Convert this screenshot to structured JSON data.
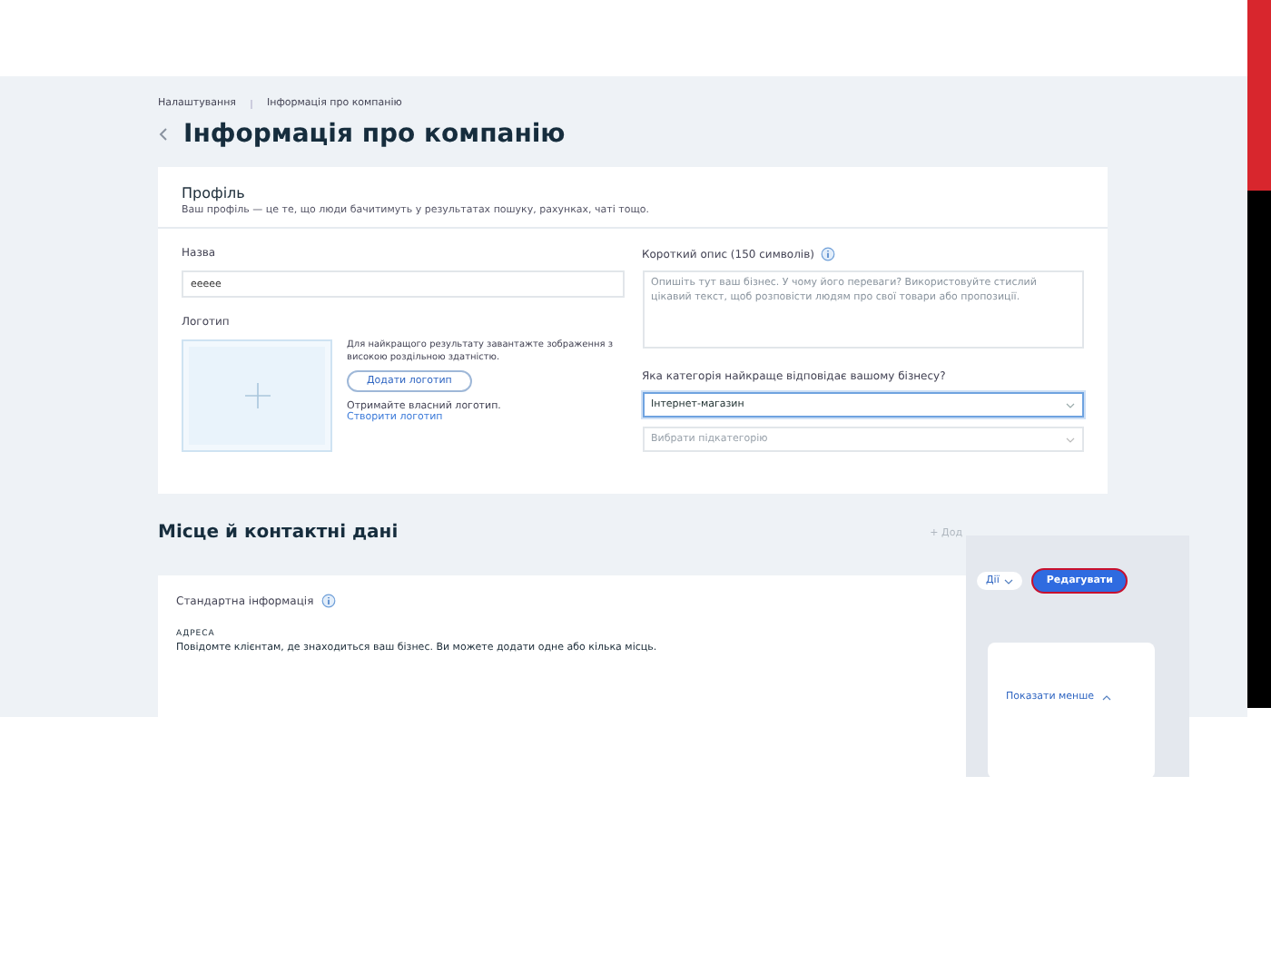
{
  "breadcrumb": [
    {
      "label": "Налаштування"
    },
    {
      "label": "Інформація про компанію"
    }
  ],
  "page_title": "Інформація про компанію",
  "profile": {
    "title": "Профіль",
    "description": "Ваш профіль — це те, що люди бачитимуть у результатах пошуку, рахунках, чаті тощо.",
    "name_field": {
      "label": "Назва",
      "value": "eeeee"
    },
    "logo": {
      "label": "Логотип",
      "hint": "Для найкращого результату завантажте зображення з високою роздільною здатністю.",
      "button": "Додати логотип",
      "prompt": "Отримайте власний логотип.",
      "link": "Створити логотип"
    },
    "short_description": {
      "label": "Короткий опис (150 символів)",
      "placeholder": "Опишіть тут ваш бізнес. У чому його переваги? Використовуйте стислий цікавий текст, щоб розповісти людям про свої товари або пропозиції."
    },
    "category": {
      "label": "Яка категорія найкраще відповідає вашому бізнесу?",
      "value": "Інтернет-магазин",
      "sub_placeholder": "Вибрати підкатегорію"
    }
  },
  "contacts": {
    "title": "Місце й контактні дані",
    "add_button": "+ Дод",
    "section": "Стандартна інформація",
    "address_label": "АДРЕСА",
    "address_text": "Повідомте клієнтам, де знаходиться ваш бізнес. Ви можете додати одне або кілька місць."
  },
  "inset": {
    "actions_button": "Дії",
    "edit_button": "Редагувати",
    "toggle_link": "Показати менше"
  }
}
